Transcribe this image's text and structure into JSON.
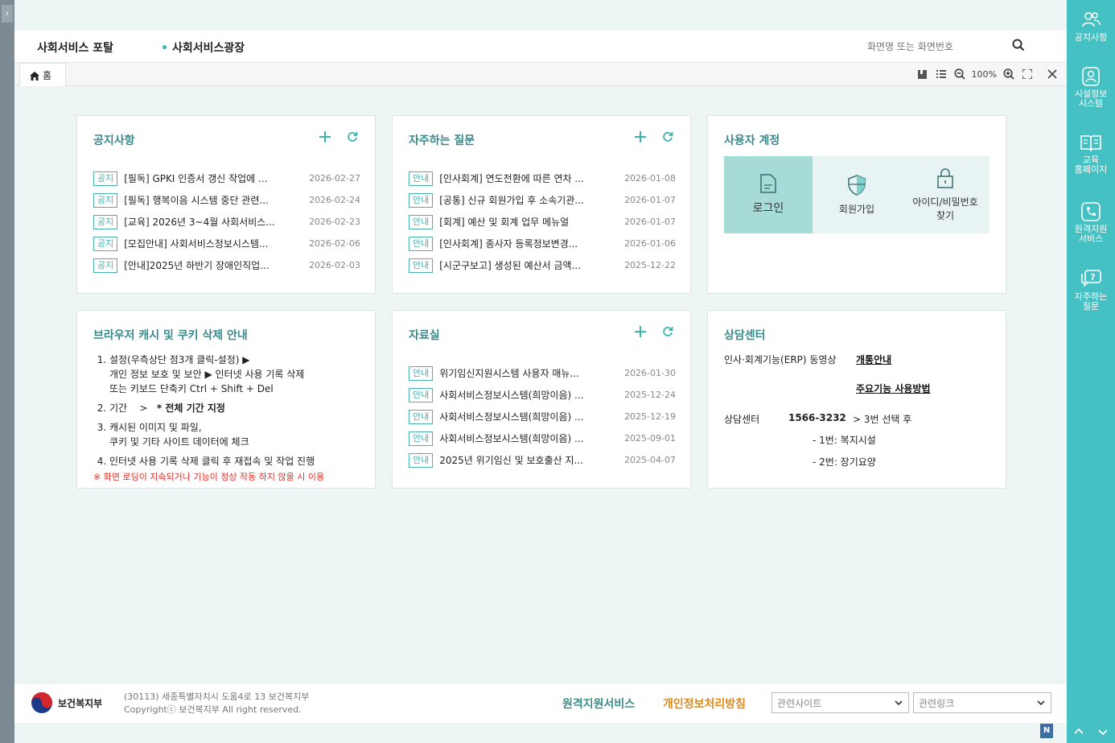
{
  "header": {
    "title": "사회서비스 포탈",
    "subtitle": "사회서비스광장",
    "search_placeholder": "화면명 또는 화면번호"
  },
  "tabbar": {
    "home_tab": "홈",
    "zoom": "100%"
  },
  "notices": {
    "title": "공지사항",
    "items": [
      {
        "badge": "공지",
        "text": "[필독] GPKI 인증서 갱신 작업에 ...",
        "date": "2026-02-27"
      },
      {
        "badge": "공지",
        "text": "[필독] 행복이음 시스템 중단 관련...",
        "date": "2026-02-24"
      },
      {
        "badge": "공지",
        "text": "[교육] 2026년 3~4월 사회서비스...",
        "date": "2026-02-23"
      },
      {
        "badge": "공지",
        "text": "[모집안내] 사회서비스정보시스템...",
        "date": "2026-02-06"
      },
      {
        "badge": "공지",
        "text": "[안내]2025년 하반기 장애인직업...",
        "date": "2026-02-03"
      }
    ]
  },
  "faq": {
    "title": "자주하는 질문",
    "items": [
      {
        "badge": "안내",
        "text": "[인사회계] 연도전환에 따른 연차 ...",
        "date": "2026-01-08"
      },
      {
        "badge": "안내",
        "text": "[공통] 신규 회원가입 후 소속기관...",
        "date": "2026-01-07"
      },
      {
        "badge": "안내",
        "text": "[회계] 예산 및 회계 업무 메뉴얼",
        "date": "2026-01-07"
      },
      {
        "badge": "안내",
        "text": "[인사회계] 종사자 등록정보변경...",
        "date": "2026-01-06"
      },
      {
        "badge": "안내",
        "text": "[시군구보고] 생성된 예산서 금액...",
        "date": "2025-12-22"
      }
    ]
  },
  "account": {
    "title": "사용자 계정",
    "login": "로그인",
    "signup": "회원가입",
    "find_line1": "아이디/비밀번호",
    "find_line2": "찾기"
  },
  "guide": {
    "title": "브라우저 캐시 및 쿠키 삭제 안내",
    "step1_a": "설정(우측상단 점3개 클릭-설정)",
    "step1_b": "개인 정보 보호 및 보안",
    "step1_c": "인터넷 사용 기록 삭제",
    "step1_d": "또는 키보드 단축키 Ctrl + Shift + Del",
    "step2_a": "기간",
    "step2_b": ">",
    "step2_c": "* 전체 기간 지정",
    "step3_a": "캐시된 이미지 및 파일,",
    "step3_b": "쿠키 및 기타 사이트 데이터에 체크",
    "step4": "인터넷 사용 기록 삭제 클릭 후 재접속 및 작업 진행",
    "warning": "※ 화면 로딩이 지속되거나 기능이 정상 작동 하지 않을 시 이용"
  },
  "library": {
    "title": "자료실",
    "items": [
      {
        "badge": "안내",
        "text": "위기임신지원시스템 사용자 매뉴...",
        "date": "2026-01-30"
      },
      {
        "badge": "안내",
        "text": "사회서비스정보시스템(희망이음) ...",
        "date": "2025-12-24"
      },
      {
        "badge": "안내",
        "text": "사회서비스정보시스템(희망이음) ...",
        "date": "2025-12-19"
      },
      {
        "badge": "안내",
        "text": "사회서비스정보시스템(희망이음) ...",
        "date": "2025-09-01"
      },
      {
        "badge": "안내",
        "text": "2025년 위기임신 및 보호출산 지...",
        "date": "2025-04-07"
      }
    ]
  },
  "consult": {
    "title": "상담센터",
    "erp_label": "인사·회계기능(ERP) 동영상",
    "link1": "개통안내",
    "link2": "주요기능 사용방법",
    "center_label": "상담센터",
    "phone": "1566-3232",
    "phone_suffix": "> 3번 선택 후",
    "opt1": "- 1번: 복지시설",
    "opt2": "- 2번: 장기요양"
  },
  "footer": {
    "org": "보건복지부",
    "address": "(30113) 세종특별자치시 도움4로 13 보건복지부",
    "copyright": "Copyrightⓒ 보건복지부 All right reserved.",
    "remote": "원격지원서비스",
    "privacy": "개인정보처리방침",
    "select1": "관련사이트",
    "select2": "관련링크"
  },
  "rightbar": {
    "item1": "공지사항",
    "item2_a": "시설정보",
    "item2_b": "시스템",
    "item3_a": "교육",
    "item3_b": "홈페이지",
    "item4_a": "원격지원",
    "item4_b": "서비스",
    "item5_a": "자주하는",
    "item5_b": "질문"
  },
  "taskbar": {
    "badge": "N"
  },
  "colors": {
    "accent": "#45c1c3",
    "badge": "#47b1ae",
    "heading": "#3a8a8c",
    "warn": "#e0312a",
    "privacy": "#e08a1a"
  }
}
